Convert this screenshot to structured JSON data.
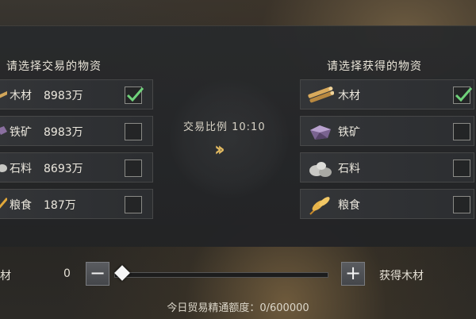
{
  "left_column": {
    "title": "请选择交易的物资",
    "items": [
      {
        "name": "木材",
        "amount": "8983万",
        "checked": true,
        "icon": "wood-icon"
      },
      {
        "name": "铁矿",
        "amount": "8983万",
        "checked": false,
        "icon": "iron-ore-icon"
      },
      {
        "name": "石料",
        "amount": "8693万",
        "checked": false,
        "icon": "stone-icon"
      },
      {
        "name": "粮食",
        "amount": "187万",
        "checked": false,
        "icon": "grain-icon"
      }
    ]
  },
  "right_column": {
    "title": "请选择获得的物资",
    "items": [
      {
        "name": "木材",
        "checked": true,
        "icon": "wood-icon"
      },
      {
        "name": "铁矿",
        "checked": false,
        "icon": "iron-ore-icon"
      },
      {
        "name": "石料",
        "checked": false,
        "icon": "stone-icon"
      },
      {
        "name": "粮食",
        "checked": false,
        "icon": "grain-icon"
      }
    ]
  },
  "exchange": {
    "ratio_label": "交易比例 10:10",
    "arrows": "››"
  },
  "slider": {
    "label": "材",
    "value": "0",
    "minus": "−",
    "plus": "+",
    "obtain_label": "获得木材",
    "fraction": 0
  },
  "quota": "今日贸易精通额度：0/600000",
  "colors": {
    "check": "#6fd27a",
    "accent_gold": "#e0b860"
  }
}
